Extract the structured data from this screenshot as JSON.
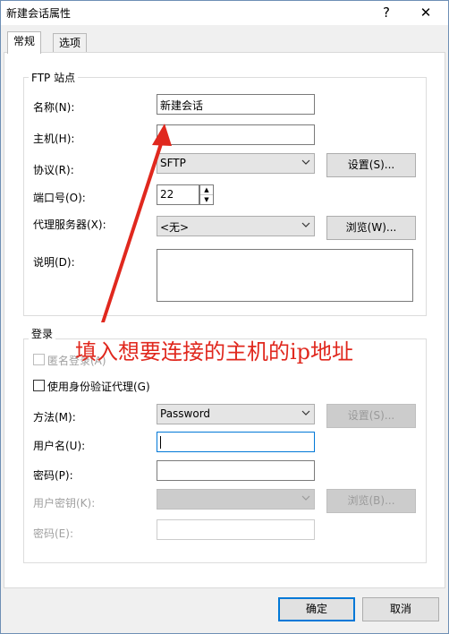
{
  "window": {
    "title": "新建会话属性",
    "help_label": "?",
    "close_label": "✕"
  },
  "tabs": [
    {
      "label": "常规",
      "active": true
    },
    {
      "label": "选项",
      "active": false
    }
  ],
  "ftp": {
    "group_label": "FTP 站点",
    "name_label": "名称(N):",
    "name_value": "新建会话",
    "host_label": "主机(H):",
    "host_value": "",
    "protocol_label": "协议(R):",
    "protocol_value": "SFTP",
    "settings_label": "设置(S)...",
    "port_label": "端口号(O):",
    "port_value": "22",
    "proxy_label": "代理服务器(X):",
    "proxy_value": "<无>",
    "browse_label": "浏览(W)...",
    "desc_label": "说明(D):",
    "desc_value": ""
  },
  "login": {
    "group_label": "登录",
    "anonymous_label": "匿名登录(A)",
    "agent_label": "使用身份验证代理(G)",
    "method_label": "方法(M):",
    "method_value": "Password",
    "settings_label": "设置(S)...",
    "username_label": "用户名(U):",
    "username_value": "",
    "password_label": "密码(P):",
    "password_value": "",
    "userkey_label": "用户密钥(K):",
    "userkey_value": "",
    "browse_label": "浏览(B)...",
    "passphrase_label": "密码(E):",
    "passphrase_value": ""
  },
  "footer": {
    "ok_label": "确定",
    "cancel_label": "取消"
  },
  "annotation": {
    "text": "填入想要连接的主机的ip地址",
    "color": "#e0281e"
  },
  "colors": {
    "accent": "#0078d7",
    "annotation": "#e0281e"
  }
}
